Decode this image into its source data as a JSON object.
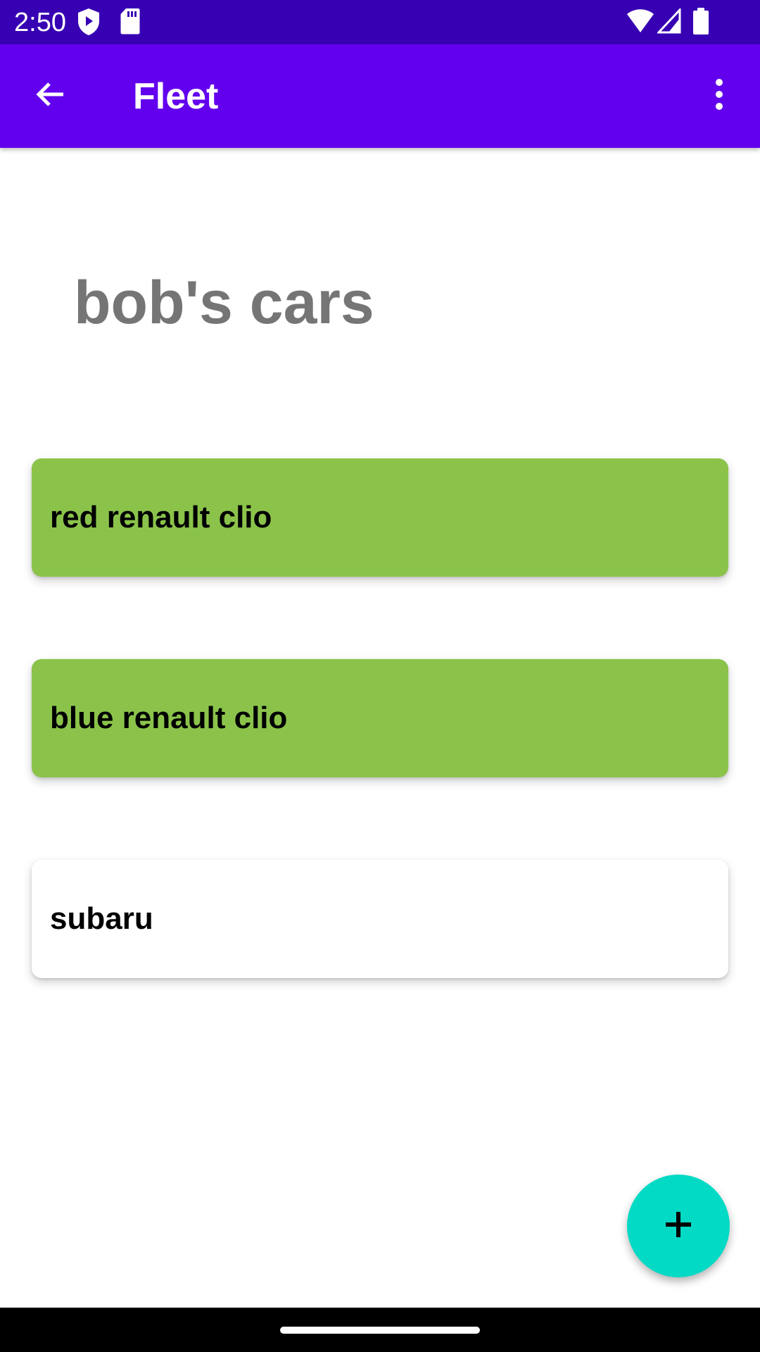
{
  "status_bar": {
    "time": "2:50",
    "icons": [
      "play-protect-icon",
      "sd-card-icon",
      "wifi-icon",
      "signal-icon",
      "battery-icon"
    ]
  },
  "app_bar": {
    "title": "Fleet",
    "back_icon": "arrow-back-icon",
    "menu_icon": "more-vert-icon"
  },
  "fleet": {
    "name": "bob's cars"
  },
  "cars": [
    {
      "label": "red renault clio",
      "selected": true
    },
    {
      "label": "blue renault clio",
      "selected": true
    },
    {
      "label": "subaru",
      "selected": false
    }
  ],
  "fab": {
    "icon": "add-icon"
  },
  "colors": {
    "status_bar": "#3700b3",
    "app_bar": "#6200ee",
    "selected_card": "#8bc34a",
    "fab": "#03dac5",
    "fleet_name": "#757575"
  }
}
